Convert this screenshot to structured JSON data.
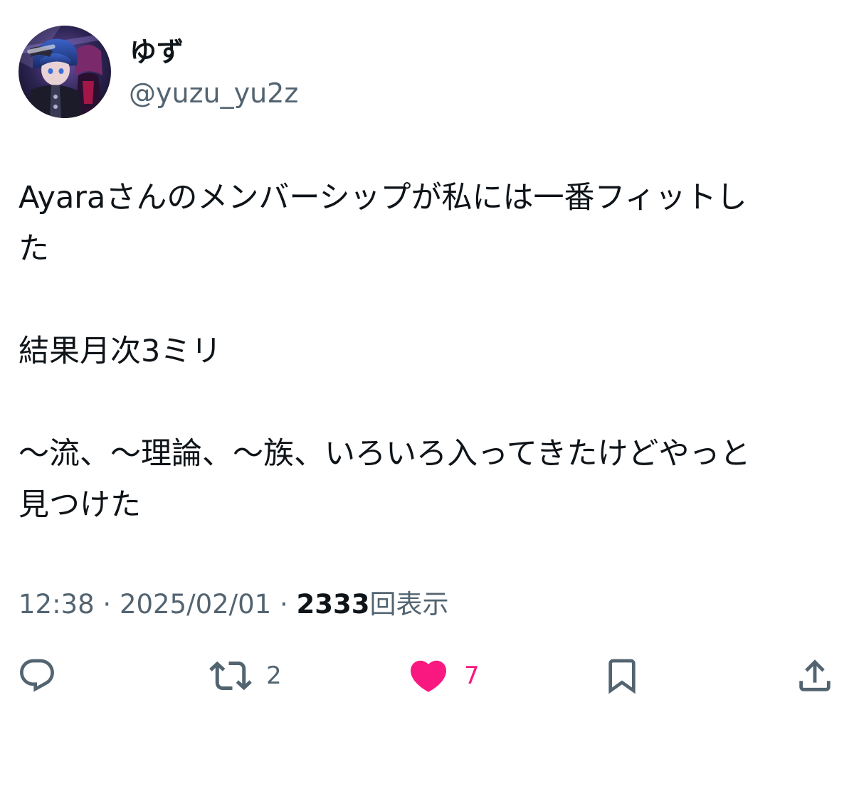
{
  "author": {
    "display_name": "ゆず",
    "handle": "@yuzu_yu2z",
    "avatar_icon": "avatar-anime-character"
  },
  "tweet": {
    "lines": [
      "Ayaraさんのメンバーシップが私には一番フィットし",
      "た",
      "",
      "結果月次3ミリ",
      "",
      "〜流、〜理論、〜族、いろいろ入ってきたけどやっと",
      "見つけた"
    ]
  },
  "meta": {
    "time": "12:38",
    "separator": "·",
    "date": "2025/02/01",
    "views_count": "2333",
    "views_label": "回表示"
  },
  "actions": {
    "reply": {
      "icon": "reply-icon",
      "count": ""
    },
    "retweet": {
      "icon": "retweet-icon",
      "count": "2"
    },
    "like": {
      "icon": "heart-filled-icon",
      "count": "7",
      "color": "#f91880"
    },
    "bookmark": {
      "icon": "bookmark-icon"
    },
    "share": {
      "icon": "share-icon"
    }
  },
  "colors": {
    "text_primary": "#0f1419",
    "text_secondary": "#536471",
    "like_pink": "#f91880",
    "background": "#ffffff"
  }
}
